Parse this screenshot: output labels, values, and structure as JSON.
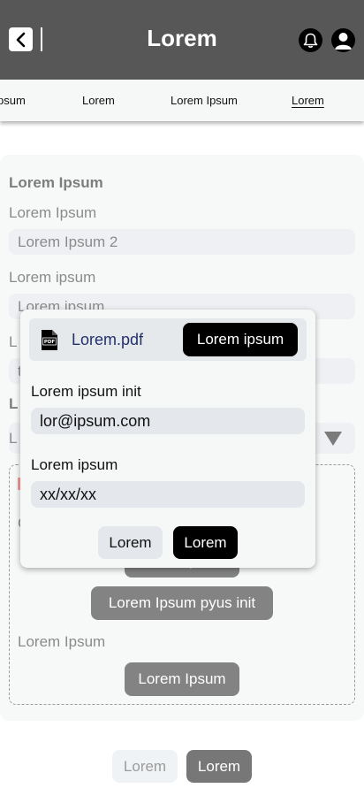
{
  "header": {
    "title": "Lorem"
  },
  "tabs": [
    {
      "label": "psum"
    },
    {
      "label": "Lorem"
    },
    {
      "label": "Lorem Ipsum"
    },
    {
      "label": "Lorem"
    }
  ],
  "form": {
    "section_title": "Lorem Ipsum",
    "field1_label": "Lorem Ipsum",
    "field1_value": "Lorem Ipsum 2",
    "field2_label": "Lorem ipsum",
    "field2_value": "Lorem ipsum",
    "field3_label": "L",
    "field3_value": "t",
    "section2_title": "L",
    "select_label": "L",
    "upload_label_partial": "C",
    "button_partial": "Lorem Ipsum",
    "button_pyus": "Lorem Ipsum pyus init",
    "lower_label": "Lorem Ipsum",
    "lower_button": "Lorem Ipsum"
  },
  "footer": {
    "back_label": "Lorem",
    "next_label": "Lorem"
  },
  "modal": {
    "file_name": "Lorem.pdf",
    "file_button": "Lorem ipsum",
    "email_label": "Lorem ipsum init",
    "email_value": "lor@ipsum.com",
    "date_label": "Lorem ipsum",
    "date_value": "xx/xx/xx",
    "cancel_label": "Lorem",
    "ok_label": "Lorem"
  },
  "icons": {
    "back": "chevron-left-icon",
    "bell": "bell-icon",
    "user": "user-icon",
    "pdf": "pdf-file-icon",
    "select": "triangle-down-icon"
  }
}
